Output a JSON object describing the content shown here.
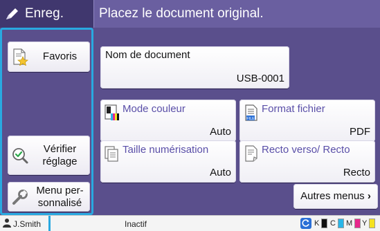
{
  "header": {
    "mode_label": "Enreg.",
    "message": "Placez le document original."
  },
  "sidebar": {
    "favorites_label": "Favoris",
    "check_settings_label": "Vérifier\nréglage",
    "custom_menu_label": "Menu per-\nsonnalisé"
  },
  "main": {
    "document_name": {
      "label": "Nom de document",
      "value": "USB-0001"
    },
    "options": [
      {
        "label": "Mode couleur",
        "value": "Auto",
        "icon": "color-mode-icon"
      },
      {
        "label": "Format fichier",
        "value": "PDF",
        "icon": "file-format-icon"
      },
      {
        "label": "Taille numérisation",
        "value": "Auto",
        "icon": "scan-size-icon"
      },
      {
        "label": "Recto verso/ Recto",
        "value": "Recto",
        "icon": "duplex-icon"
      }
    ],
    "more_menus_label": "Autres menus"
  },
  "status_bar": {
    "user": "J.Smith",
    "state": "Inactif",
    "inks": [
      {
        "letter": "K",
        "color": "#111111"
      },
      {
        "letter": "C",
        "color": "#29b6e8"
      },
      {
        "letter": "M",
        "color": "#e8288c"
      },
      {
        "letter": "Y",
        "color": "#f5e21e"
      }
    ]
  },
  "colors": {
    "header_left": "#40376e",
    "header_right": "#6a5fa0",
    "background": "#5a4f8c",
    "focus_border": "#29a9e0",
    "option_label": "#5a4fa8"
  }
}
